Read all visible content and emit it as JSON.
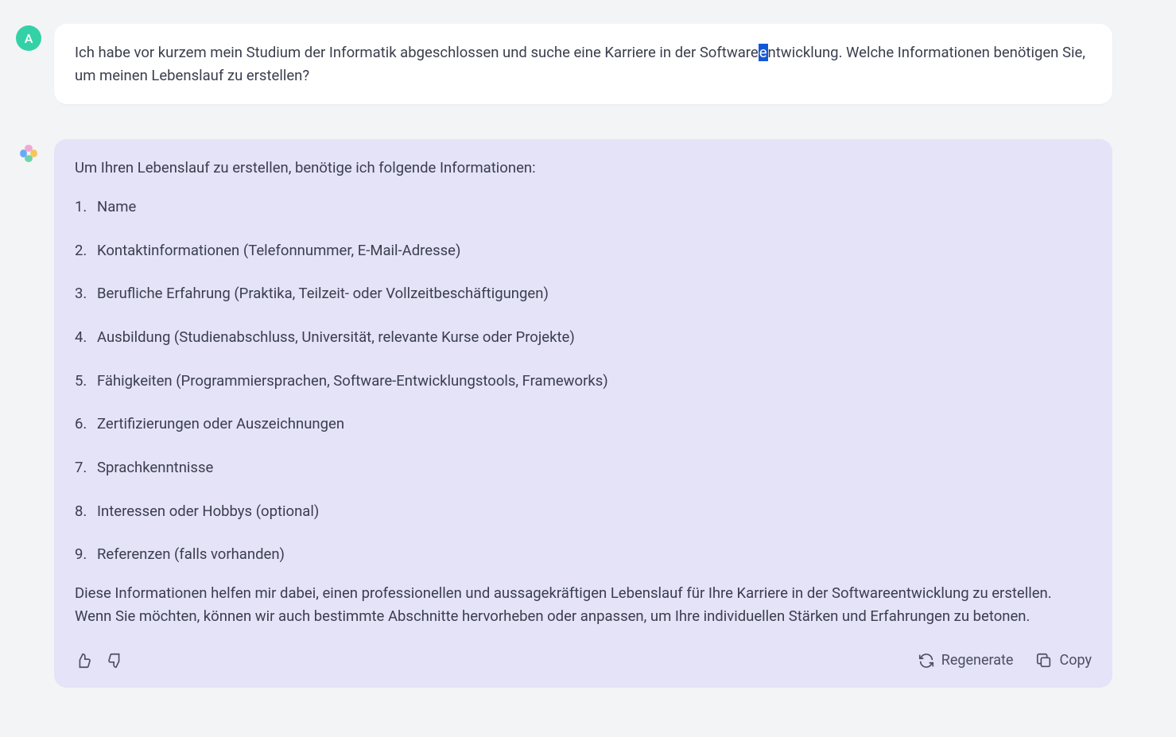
{
  "user": {
    "avatar_letter": "A",
    "message": {
      "pre": "Ich habe vor kurzem mein Studium der Informatik abgeschlossen und suche eine Karriere in der Software",
      "highlight": "e",
      "post": "ntwicklung. Welche Informationen benötigen Sie, um meinen Lebenslauf zu erstellen?"
    }
  },
  "assistant": {
    "intro": "Um Ihren Lebenslauf zu erstellen, benötige ich folgende Informationen:",
    "items": [
      "Name",
      "Kontaktinformationen (Telefonnummer, E-Mail-Adresse)",
      "Berufliche Erfahrung (Praktika, Teilzeit- oder Vollzeitbeschäftigungen)",
      "Ausbildung (Studienabschluss, Universität, relevante Kurse oder Projekte)",
      "Fähigkeiten (Programmiersprachen, Software-Entwicklungstools, Frameworks)",
      "Zertifizierungen oder Auszeichnungen",
      "Sprachkenntnisse",
      "Interessen oder Hobbys (optional)",
      "Referenzen (falls vorhanden)"
    ],
    "outro": "Diese Informationen helfen mir dabei, einen professionellen und aussagekräftigen Lebenslauf für Ihre Karriere in der Softwareentwicklung zu erstellen. Wenn Sie möchten, können wir auch bestimmte Abschnitte hervorheben oder anpassen, um Ihre individuellen Stärken und Erfahrungen zu betonen."
  },
  "actions": {
    "regenerate": "Regenerate",
    "copy": "Copy"
  }
}
